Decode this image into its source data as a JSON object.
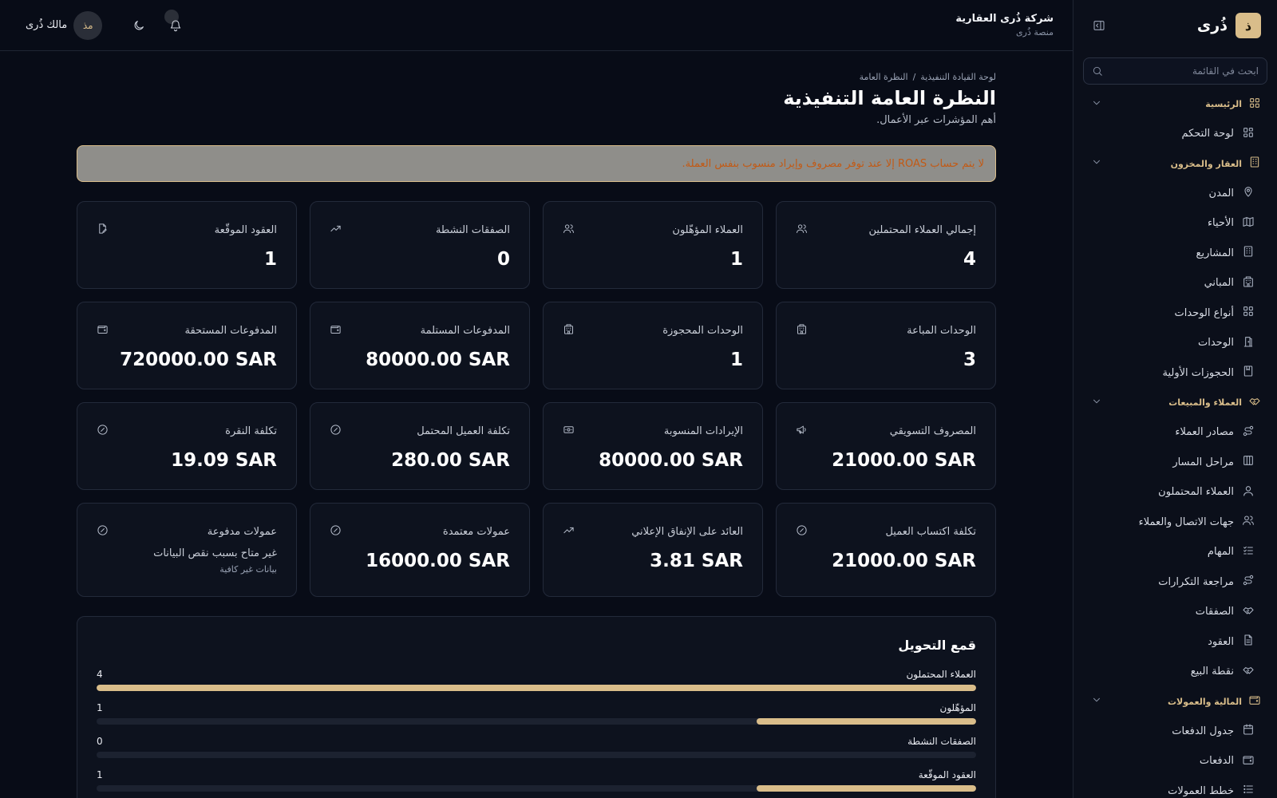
{
  "brand": {
    "logo_letter": "ذ",
    "name": "ذُرى",
    "accent": "#d9bd8a"
  },
  "sidebar": {
    "search_placeholder": "ابحث في القائمة",
    "groups": [
      {
        "label": "الرئيسية",
        "icon": "grid-icon",
        "items": [
          {
            "label": "لوحة التحكم",
            "icon": "dashboard-icon"
          }
        ]
      },
      {
        "label": "العقار والمخزون",
        "icon": "building-icon",
        "items": [
          {
            "label": "المدن",
            "icon": "map-pin-icon"
          },
          {
            "label": "الأحياء",
            "icon": "map-icon"
          },
          {
            "label": "المشاريع",
            "icon": "building-icon"
          },
          {
            "label": "المباني",
            "icon": "buildings-icon"
          },
          {
            "label": "أنواع الوحدات",
            "icon": "grid-icon"
          },
          {
            "label": "الوحدات",
            "icon": "door-icon"
          },
          {
            "label": "الحجوزات الأولية",
            "icon": "bookmark-icon"
          }
        ]
      },
      {
        "label": "العملاء والمبيعات",
        "icon": "handshake-icon",
        "items": [
          {
            "label": "مصادر العملاء",
            "icon": "route-icon"
          },
          {
            "label": "مراحل المسار",
            "icon": "kanban-icon"
          },
          {
            "label": "العملاء المحتملون",
            "icon": "user-icon"
          },
          {
            "label": "جهات الاتصال والعملاء",
            "icon": "users-icon"
          },
          {
            "label": "المهام",
            "icon": "checklist-icon"
          },
          {
            "label": "مراجعة التكرارات",
            "icon": "route-icon"
          },
          {
            "label": "الصفقات",
            "icon": "handshake-icon"
          },
          {
            "label": "العقود",
            "icon": "file-icon"
          },
          {
            "label": "نقطة البيع",
            "icon": "handshake-icon"
          }
        ]
      },
      {
        "label": "المالية والعمولات",
        "icon": "wallet-icon",
        "items": [
          {
            "label": "جدول الدفعات",
            "icon": "calendar-icon"
          },
          {
            "label": "الدفعات",
            "icon": "wallet-icon"
          },
          {
            "label": "خطط العمولات",
            "icon": "list-icon"
          }
        ]
      }
    ]
  },
  "header": {
    "company_name": "شركة ذُرى العقارية",
    "company_sub": "منصة ذُرى",
    "user_name": "مالك ذُرى",
    "user_initials": "مذ"
  },
  "page": {
    "breadcrumb": [
      "لوحة القيادة التنفيذية",
      "/",
      "النظرة العامة"
    ],
    "title": "النظرة العامة التنفيذية",
    "subtitle": "أهم المؤشرات عبر الأعمال.",
    "alert": "لا يتم حساب ROAS إلا عند توفر مصروف وإيراد منسوب بنفس العملة."
  },
  "cards": [
    {
      "label": "إجمالي العملاء المحتملين",
      "value": "4",
      "icon": "users-icon"
    },
    {
      "label": "العملاء المؤهّلون",
      "value": "1",
      "icon": "users-icon"
    },
    {
      "label": "الصفقات النشطة",
      "value": "0",
      "icon": "trend-up-icon"
    },
    {
      "label": "العقود الموقّعة",
      "value": "1",
      "icon": "file-sign-icon"
    },
    {
      "label": "الوحدات المباعة",
      "value": "3",
      "icon": "buildings-icon"
    },
    {
      "label": "الوحدات المحجوزة",
      "value": "1",
      "icon": "buildings-icon"
    },
    {
      "label": "المدفوعات المستلمة",
      "value": "80000.00 SAR",
      "icon": "wallet-icon"
    },
    {
      "label": "المدفوعات المستحقة",
      "value": "720000.00 SAR",
      "icon": "wallet-icon"
    },
    {
      "label": "المصروف التسويقي",
      "value": "21000.00 SAR",
      "icon": "megaphone-icon"
    },
    {
      "label": "الإيرادات المنسوبة",
      "value": "80000.00 SAR",
      "icon": "banknote-icon"
    },
    {
      "label": "تكلفة العميل المحتمل",
      "value": "280.00 SAR",
      "icon": "gauge-icon"
    },
    {
      "label": "تكلفة النقرة",
      "value": "19.09 SAR",
      "icon": "gauge-icon"
    },
    {
      "label": "تكلفة اكتساب العميل",
      "value": "21000.00 SAR",
      "icon": "gauge-icon"
    },
    {
      "label": "العائد على الإنفاق الإعلاني",
      "value": "3.81 SAR",
      "icon": "trend-up-icon"
    },
    {
      "label": "عمولات معتمدة",
      "value": "16000.00 SAR",
      "icon": "gauge-icon"
    },
    {
      "label": "عمولات مدفوعة",
      "value": "",
      "note": "غير متاح بسبب نقص البيانات",
      "small": "بيانات غير كافية",
      "icon": "gauge-icon"
    }
  ],
  "funnel": {
    "title": "قمع التحويل",
    "max": 4,
    "rows": [
      {
        "label": "العملاء المحتملون",
        "value": 4
      },
      {
        "label": "المؤهّلون",
        "value": 1
      },
      {
        "label": "الصفقات النشطة",
        "value": 0
      },
      {
        "label": "العقود الموقّعة",
        "value": 1
      }
    ]
  }
}
